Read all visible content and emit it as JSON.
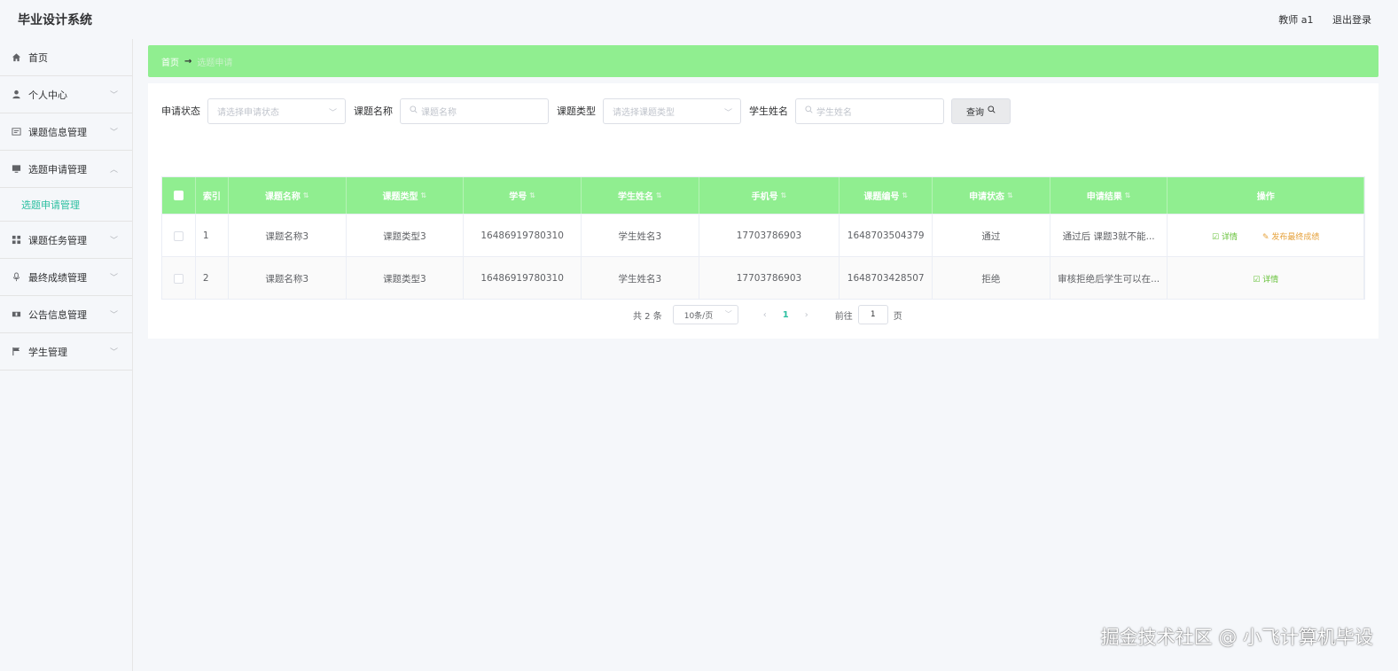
{
  "header": {
    "app_title": "毕业设计系统",
    "user_label": "教师 a1",
    "logout_label": "退出登录"
  },
  "sidebar": {
    "items": [
      {
        "label": "首页",
        "icon": "home-icon"
      },
      {
        "label": "个人中心",
        "icon": "user-icon"
      },
      {
        "label": "课题信息管理",
        "icon": "doc-icon"
      },
      {
        "label": "选题申请管理",
        "icon": "monitor-icon"
      },
      {
        "label": "课题任务管理",
        "icon": "grid-icon"
      },
      {
        "label": "最终成绩管理",
        "icon": "mic-icon"
      },
      {
        "label": "公告信息管理",
        "icon": "ticket-icon"
      },
      {
        "label": "学生管理",
        "icon": "flag-icon"
      }
    ],
    "active_sub": "选题申请管理"
  },
  "breadcrumb": {
    "home": "首页",
    "separator": "→",
    "current": "选题申请"
  },
  "filters": {
    "status_label": "申请状态",
    "status_placeholder": "请选择申请状态",
    "topic_label": "课题名称",
    "topic_placeholder": "课题名称",
    "type_label": "课题类型",
    "type_placeholder": "请选择课题类型",
    "student_label": "学生姓名",
    "student_placeholder": "学生姓名",
    "query_label": "查询"
  },
  "table": {
    "columns": [
      "索引",
      "课题名称",
      "课题类型",
      "学号",
      "学生姓名",
      "手机号",
      "课题编号",
      "申请状态",
      "申请结果",
      "操作"
    ],
    "rows": [
      {
        "index": "1",
        "topic": "课题名称3",
        "type": "课题类型3",
        "student_no": "16486919780310",
        "student_name": "学生姓名3",
        "phone": "17703786903",
        "topic_no": "1648703504379",
        "status": "通过",
        "result": "通过后 课题3就不能...",
        "actions": [
          "详情",
          "发布最终成绩"
        ]
      },
      {
        "index": "2",
        "topic": "课题名称3",
        "type": "课题类型3",
        "student_no": "16486919780310",
        "student_name": "学生姓名3",
        "phone": "17703786903",
        "topic_no": "1648703428507",
        "status": "拒绝",
        "result": "审核拒绝后学生可以在...",
        "actions": [
          "详情"
        ]
      }
    ]
  },
  "pagination": {
    "total": "共 2 条",
    "page_size": "10条/页",
    "current_page": "1",
    "goto_label": "前往",
    "goto_value": "1",
    "page_suffix": "页"
  },
  "watermark": "掘金技术社区 @ 小飞计算机毕设",
  "colors": {
    "accent_green": "#90ee90",
    "active_teal": "#2bbfa0",
    "detail_green": "#67c23a",
    "upload_orange": "#e6a23c"
  }
}
